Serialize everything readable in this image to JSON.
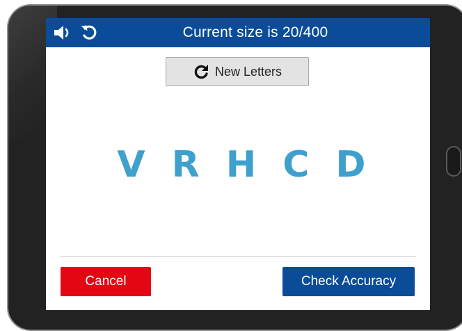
{
  "topbar": {
    "title": "Current size is 20/400",
    "sound_icon": "speaker-icon",
    "undo_icon": "undo-icon",
    "background_color": "#0b4c98"
  },
  "new_letters_button": {
    "label": "New Letters",
    "icon": "refresh-icon"
  },
  "chart": {
    "letters": [
      "V",
      "R",
      "H",
      "C",
      "D"
    ],
    "letter_color": "#3ea0cd"
  },
  "footer": {
    "cancel_label": "Cancel",
    "cancel_color": "#e30613",
    "check_label": "Check Accuracy",
    "check_color": "#0b4c98"
  }
}
